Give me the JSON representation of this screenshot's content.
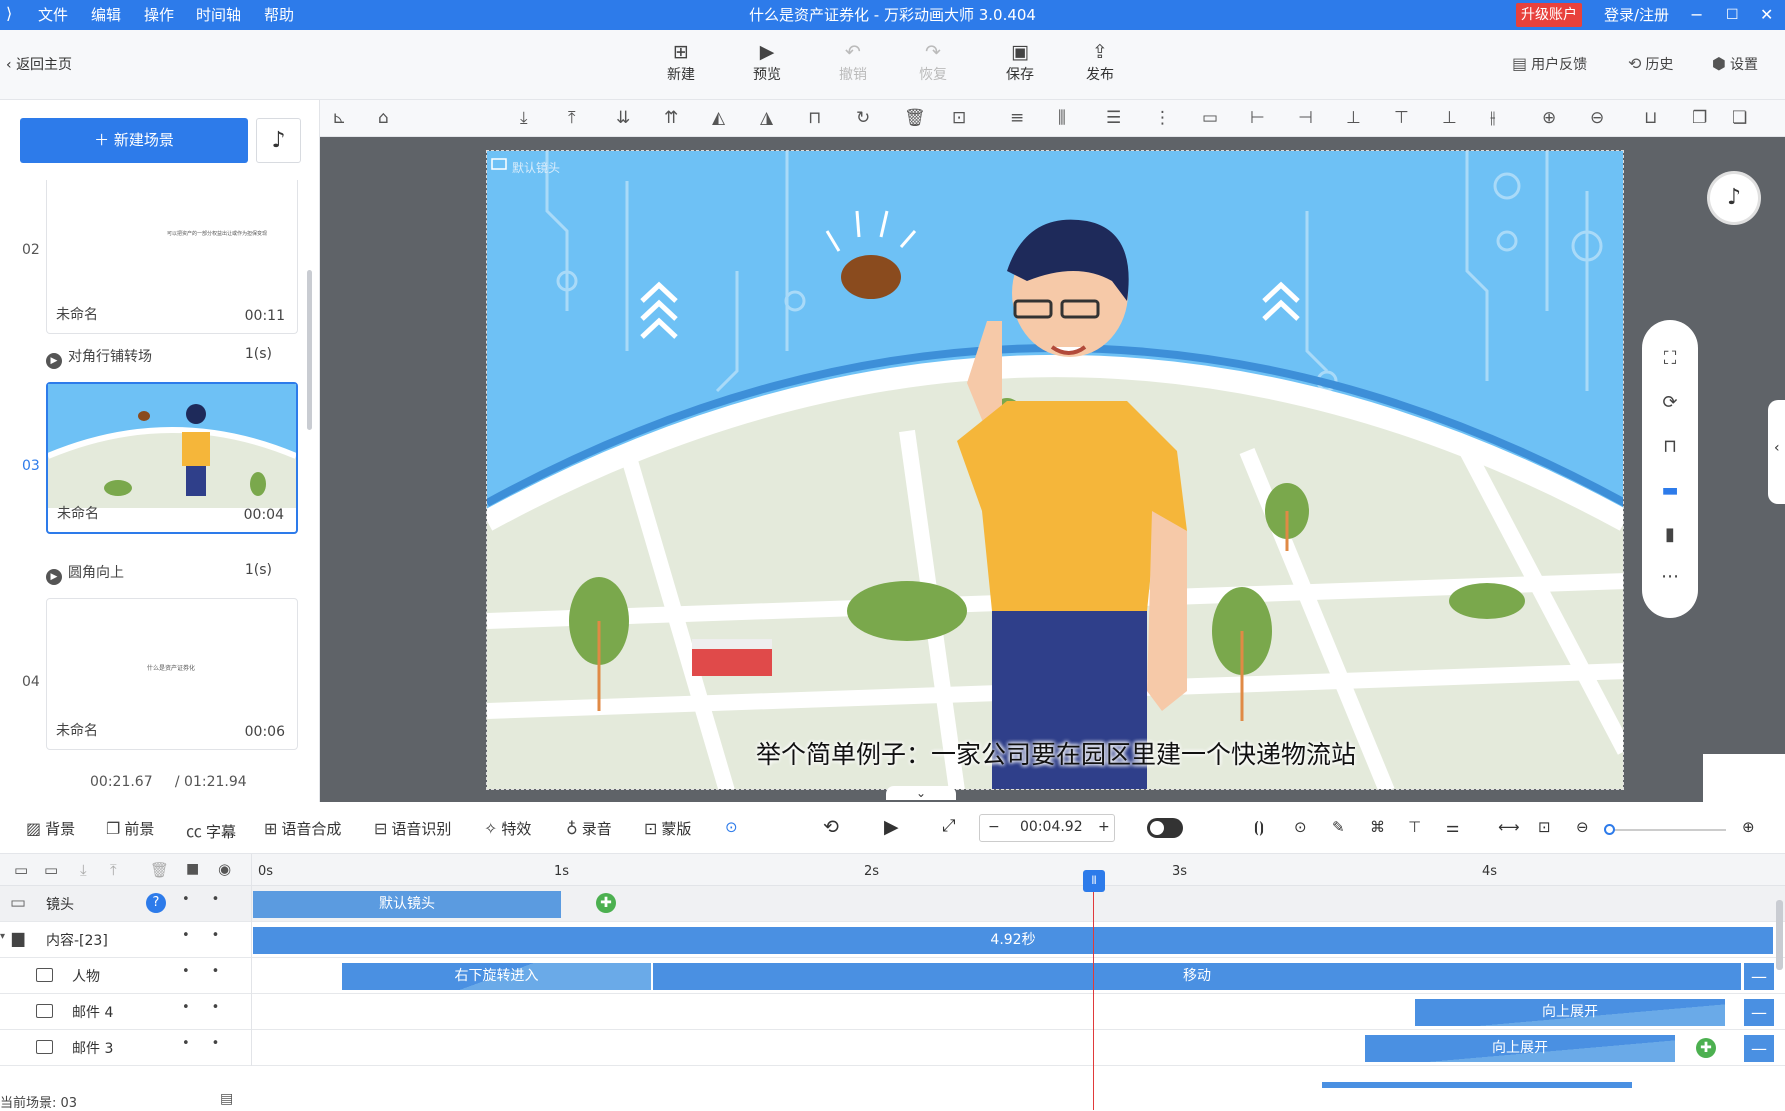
{
  "titlebar": {
    "menu": [
      "文件",
      "编辑",
      "操作",
      "时间轴",
      "帮助"
    ],
    "title": "什么是资产证券化 - 万彩动画大师 3.0.404",
    "upgrade": "升级账户",
    "login": "登录/注册"
  },
  "toolbar": {
    "back": "返回主页",
    "buttons": [
      {
        "label": "新建",
        "icon": "plus-square-icon"
      },
      {
        "label": "预览",
        "icon": "play-icon"
      },
      {
        "label": "撤销",
        "icon": "undo-icon"
      },
      {
        "label": "恢复",
        "icon": "redo-icon"
      },
      {
        "label": "保存",
        "icon": "save-icon"
      },
      {
        "label": "发布",
        "icon": "publish-icon"
      }
    ],
    "feedback": "用户反馈",
    "history": "历史",
    "settings": "设置"
  },
  "leftpanel": {
    "new_scene": "新建场景",
    "scenes": [
      {
        "number": "02",
        "name": "未命名",
        "duration": "00:11",
        "thumb_text": "可以把资产的一部分权益出让或作为担保变现"
      },
      {
        "number": "03",
        "name": "未命名",
        "duration": "00:04"
      },
      {
        "number": "04",
        "name": "未命名",
        "duration": "00:06",
        "thumb_text": "什么是资产证券化"
      }
    ],
    "transitions": [
      {
        "name": "对角行铺转场",
        "time": "1(s)"
      },
      {
        "name": "圆角向上",
        "time": "1(s)"
      }
    ],
    "current_time": "00:21.67",
    "total_time": "/ 01:21.94"
  },
  "canvas": {
    "caption": "举个简单例子：一家公司要在园区里建一个快递物流站",
    "label": "默认镜头"
  },
  "controls": {
    "buttons": [
      "背景",
      "前景",
      "字幕",
      "语音合成",
      "语音识别",
      "特效",
      "录音",
      "蒙版"
    ],
    "time": "00:04.92",
    "minus": "−",
    "plus": "+"
  },
  "timeline": {
    "ticks": [
      "0s",
      "1s",
      "2s",
      "3s",
      "4s"
    ],
    "rows": [
      {
        "label": "镜头",
        "bars": [
          {
            "text": "默认镜头"
          }
        ]
      },
      {
        "label": "内容-[23]",
        "bars": [
          {
            "text": "4.92秒"
          }
        ]
      },
      {
        "label": "人物",
        "bars": [
          {
            "text": "右下旋转进入"
          },
          {
            "text": "移动"
          }
        ]
      },
      {
        "label": "邮件 4",
        "bars": [
          {
            "text": "向上展开"
          }
        ]
      },
      {
        "label": "邮件 3",
        "bars": [
          {
            "text": "向上展开"
          }
        ]
      }
    ],
    "status": "当前场景: 03"
  },
  "colors": {
    "accent": "#2d7bea",
    "upgrade": "#e8413c",
    "playhead": "#e03a3a",
    "sky": "#6ec1f5"
  }
}
